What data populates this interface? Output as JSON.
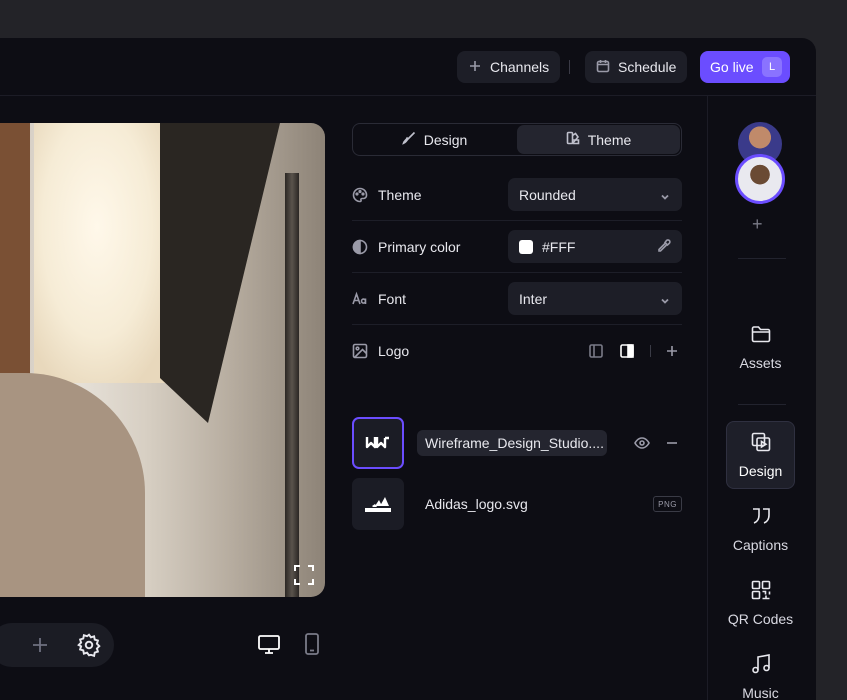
{
  "topbar": {
    "channels_label": "Channels",
    "schedule_label": "Schedule",
    "golive_label": "Go live",
    "golive_shortcut": "L"
  },
  "panel": {
    "tabs": [
      {
        "label": "Design",
        "icon": "brush-icon",
        "active": false
      },
      {
        "label": "Theme",
        "icon": "palette-swatch-icon",
        "active": true
      }
    ],
    "rows": {
      "theme": {
        "label": "Theme",
        "value": "Rounded",
        "icon": "palette-icon"
      },
      "primary_color": {
        "label": "Primary color",
        "value": "#FFF",
        "icon": "contrast-icon",
        "swatch": "#ffffff"
      },
      "font": {
        "label": "Font",
        "value": "Inter",
        "icon": "font-icon"
      },
      "logo": {
        "label": "Logo",
        "icon": "image-icon"
      }
    },
    "logos": [
      {
        "name": "Wireframe_Design_Studio....",
        "selected": true
      },
      {
        "name": "Adidas_logo.svg",
        "badge": "PNG",
        "selected": false,
        "mark": "adidas"
      }
    ]
  },
  "rail": {
    "add_label": "+",
    "items": [
      {
        "label": "Assets",
        "icon": "folder-icon"
      },
      {
        "label": "Design",
        "icon": "design-media-icon",
        "active": true
      },
      {
        "label": "Captions",
        "icon": "quote-icon"
      },
      {
        "label": "QR Codes",
        "icon": "qr-code-icon"
      },
      {
        "label": "Music",
        "icon": "music-note-icon"
      }
    ]
  },
  "colors": {
    "accent": "#6b4dff",
    "background": "#0d0d14",
    "surface": "#1d1e27"
  }
}
